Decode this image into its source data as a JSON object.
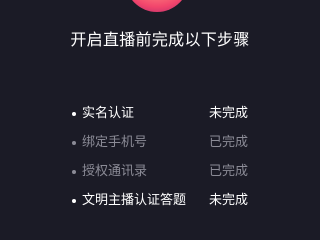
{
  "colors": {
    "background": "#1b1b26",
    "text_active": "#ffffff",
    "text_done": "#8b8b96",
    "logo_accent": "#f2456c"
  },
  "logo": {
    "icon": "live-app-logo-icon"
  },
  "heading": "开启直播前完成以下步骤",
  "steps": [
    {
      "label": "实名认证",
      "status": "未完成",
      "completed": false
    },
    {
      "label": "绑定手机号",
      "status": "已完成",
      "completed": true
    },
    {
      "label": "授权通讯录",
      "status": "已完成",
      "completed": true
    },
    {
      "label": "文明主播认证答题",
      "status": "未完成",
      "completed": false
    }
  ]
}
